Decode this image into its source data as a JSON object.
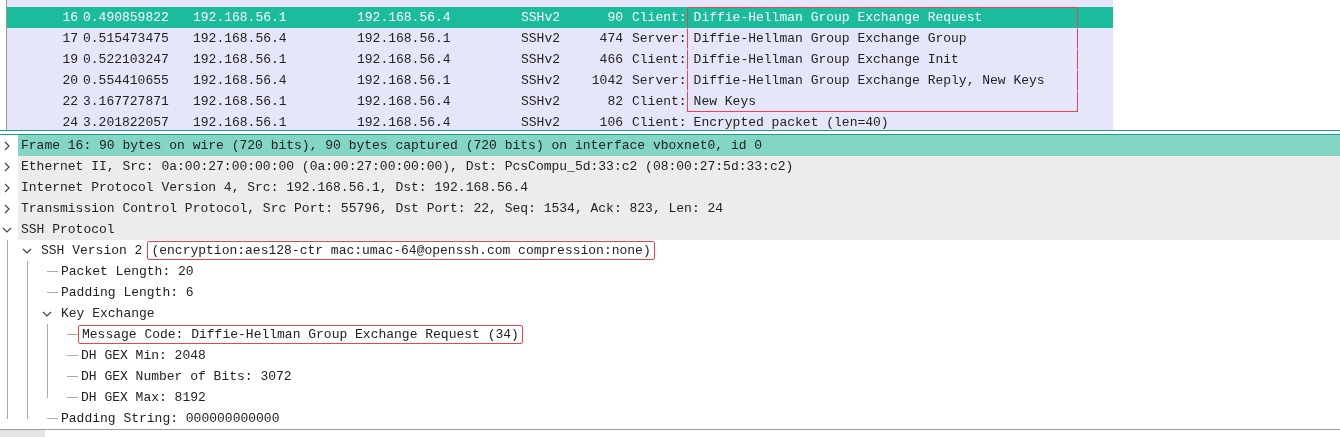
{
  "packet_list": {
    "rows": [
      {
        "no": "16",
        "time": "0.490859822",
        "source": "192.168.56.1",
        "destination": "192.168.56.4",
        "protocol": "SSHv2",
        "length": "90",
        "info_prefix": "Client:",
        "info": "Diffie-Hellman Group Exchange Request",
        "selected": true,
        "boxed": true
      },
      {
        "no": "17",
        "time": "0.515473475",
        "source": "192.168.56.4",
        "destination": "192.168.56.1",
        "protocol": "SSHv2",
        "length": "474",
        "info_prefix": "Server:",
        "info": "Diffie-Hellman Group Exchange Group",
        "selected": false,
        "boxed": true
      },
      {
        "no": "19",
        "time": "0.522103247",
        "source": "192.168.56.1",
        "destination": "192.168.56.4",
        "protocol": "SSHv2",
        "length": "466",
        "info_prefix": "Client:",
        "info": "Diffie-Hellman Group Exchange Init",
        "selected": false,
        "boxed": true
      },
      {
        "no": "20",
        "time": "0.554410655",
        "source": "192.168.56.4",
        "destination": "192.168.56.1",
        "protocol": "SSHv2",
        "length": "1042",
        "info_prefix": "Server:",
        "info": "Diffie-Hellman Group Exchange Reply, New Keys",
        "selected": false,
        "boxed": true
      },
      {
        "no": "22",
        "time": "3.167727871",
        "source": "192.168.56.1",
        "destination": "192.168.56.4",
        "protocol": "SSHv2",
        "length": "82",
        "info_prefix": "Client:",
        "info": "New Keys",
        "selected": false,
        "boxed": true
      },
      {
        "no": "24",
        "time": "3.201822057",
        "source": "192.168.56.1",
        "destination": "192.168.56.4",
        "protocol": "SSHv2",
        "length": "106",
        "info_prefix": "Client:",
        "info": "Encrypted packet (len=40)",
        "selected": false,
        "boxed": false
      }
    ]
  },
  "details_tree": [
    {
      "label": "Frame 16: 90 bytes on wire (720 bits), 90 bytes captured (720 bits) on interface vboxnet0, id 0",
      "expanded": false,
      "selected": true
    },
    {
      "label": "Ethernet II, Src: 0a:00:27:00:00:00 (0a:00:27:00:00:00), Dst: PcsCompu_5d:33:c2 (08:00:27:5d:33:c2)",
      "expanded": false,
      "selected": false
    },
    {
      "label": "Internet Protocol Version 4, Src: 192.168.56.1, Dst: 192.168.56.4",
      "expanded": false,
      "selected": false
    },
    {
      "label": "Transmission Control Protocol, Src Port: 55796, Dst Port: 22, Seq: 1534, Ack: 823, Len: 24",
      "expanded": false,
      "selected": false
    },
    {
      "label": "SSH Protocol",
      "expanded": true,
      "selected": false,
      "children": [
        {
          "label": "SSH Version 2",
          "detail": "(encryption:aes128-ctr mac:umac-64@openssh.com compression:none)",
          "detail_boxed": true,
          "expanded": true,
          "selected": false,
          "children": [
            {
              "label": "Packet Length: 20",
              "selected": false
            },
            {
              "label": "Padding Length: 6",
              "selected": false
            },
            {
              "label": "Key Exchange",
              "expanded": true,
              "selected": false,
              "children": [
                {
                  "label": "Message Code: Diffie-Hellman Group Exchange Request (34)",
                  "boxed": true,
                  "selected": false
                },
                {
                  "label": "DH GEX Min: 2048",
                  "selected": false
                },
                {
                  "label": "DH GEX Number of Bits: 3072",
                  "selected": false
                },
                {
                  "label": "DH GEX Max: 8192",
                  "selected": false
                }
              ]
            },
            {
              "label": "Padding String: 000000000000",
              "selected": false
            }
          ]
        }
      ]
    }
  ]
}
